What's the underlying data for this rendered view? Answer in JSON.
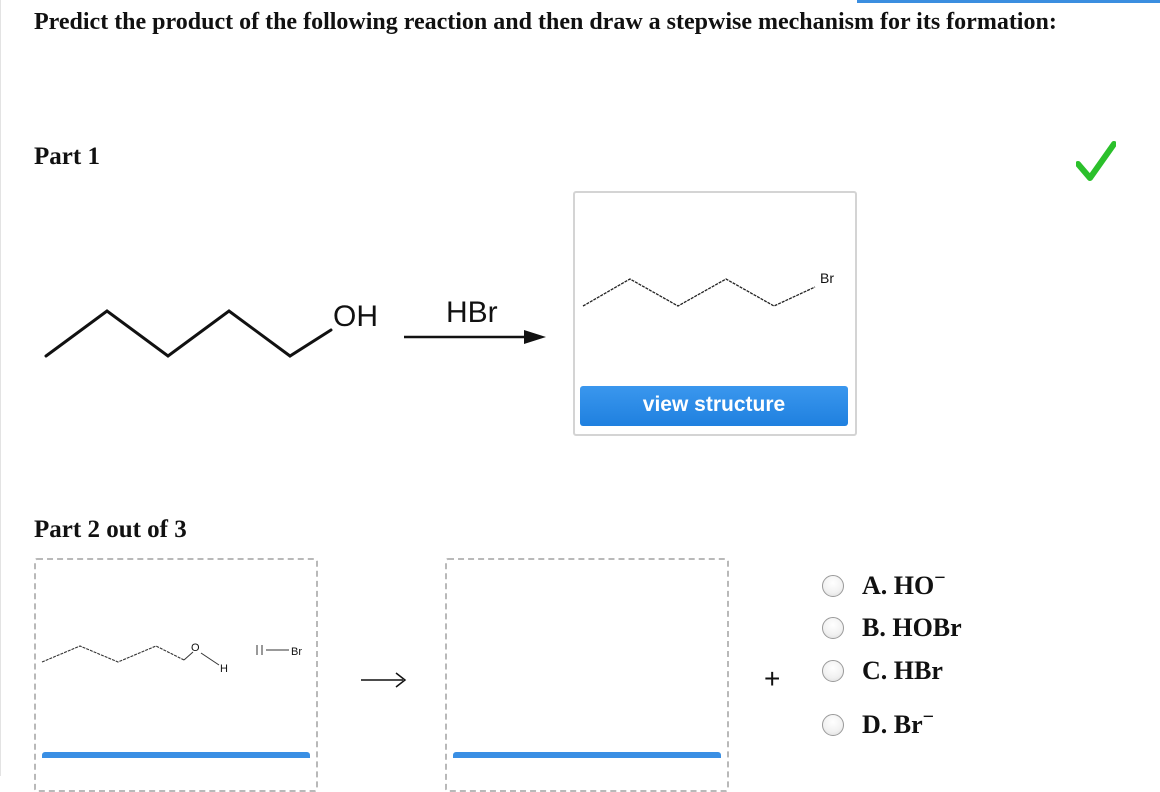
{
  "question": "Predict the product of the following reaction and then draw a stepwise mechanism for its formation:",
  "part1": {
    "title": "Part 1",
    "reactant_label": "OH",
    "reagent": "HBr",
    "product_label": "Br",
    "view_button": "view structure",
    "status": "correct"
  },
  "part2": {
    "title": "Part 2 out of 3",
    "left_labels": {
      "oxygen": "O",
      "hydrogen": "H",
      "bromine": "Br"
    },
    "plus": "+",
    "options": [
      {
        "letter": "A.",
        "text": "HO",
        "charge": "−"
      },
      {
        "letter": "B.",
        "text": "HOBr",
        "charge": ""
      },
      {
        "letter": "C.",
        "text": "HBr",
        "charge": ""
      },
      {
        "letter": "D.",
        "text": "Br",
        "charge": "−"
      }
    ]
  },
  "colors": {
    "accent": "#1f80df",
    "check": "#2bc02b",
    "dash": "#b9b9b9"
  }
}
